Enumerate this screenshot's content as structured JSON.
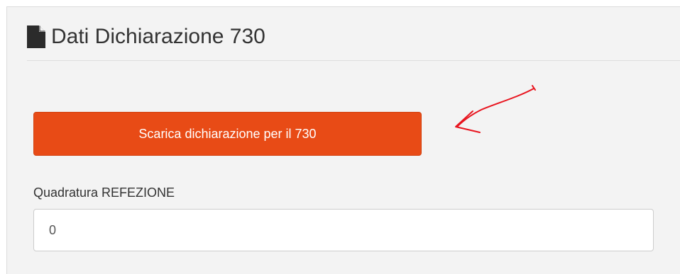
{
  "panel": {
    "title": "Dati Dichiarazione 730",
    "title_icon": "document-icon"
  },
  "actions": {
    "download_label": "Scarica dichiarazione per il 730"
  },
  "form": {
    "refezione_label": "Quadratura REFEZIONE",
    "refezione_value": "0"
  },
  "colors": {
    "button_bg": "#e84b16",
    "annotation": "#e8141e",
    "panel_bg": "#f3f3f3"
  }
}
